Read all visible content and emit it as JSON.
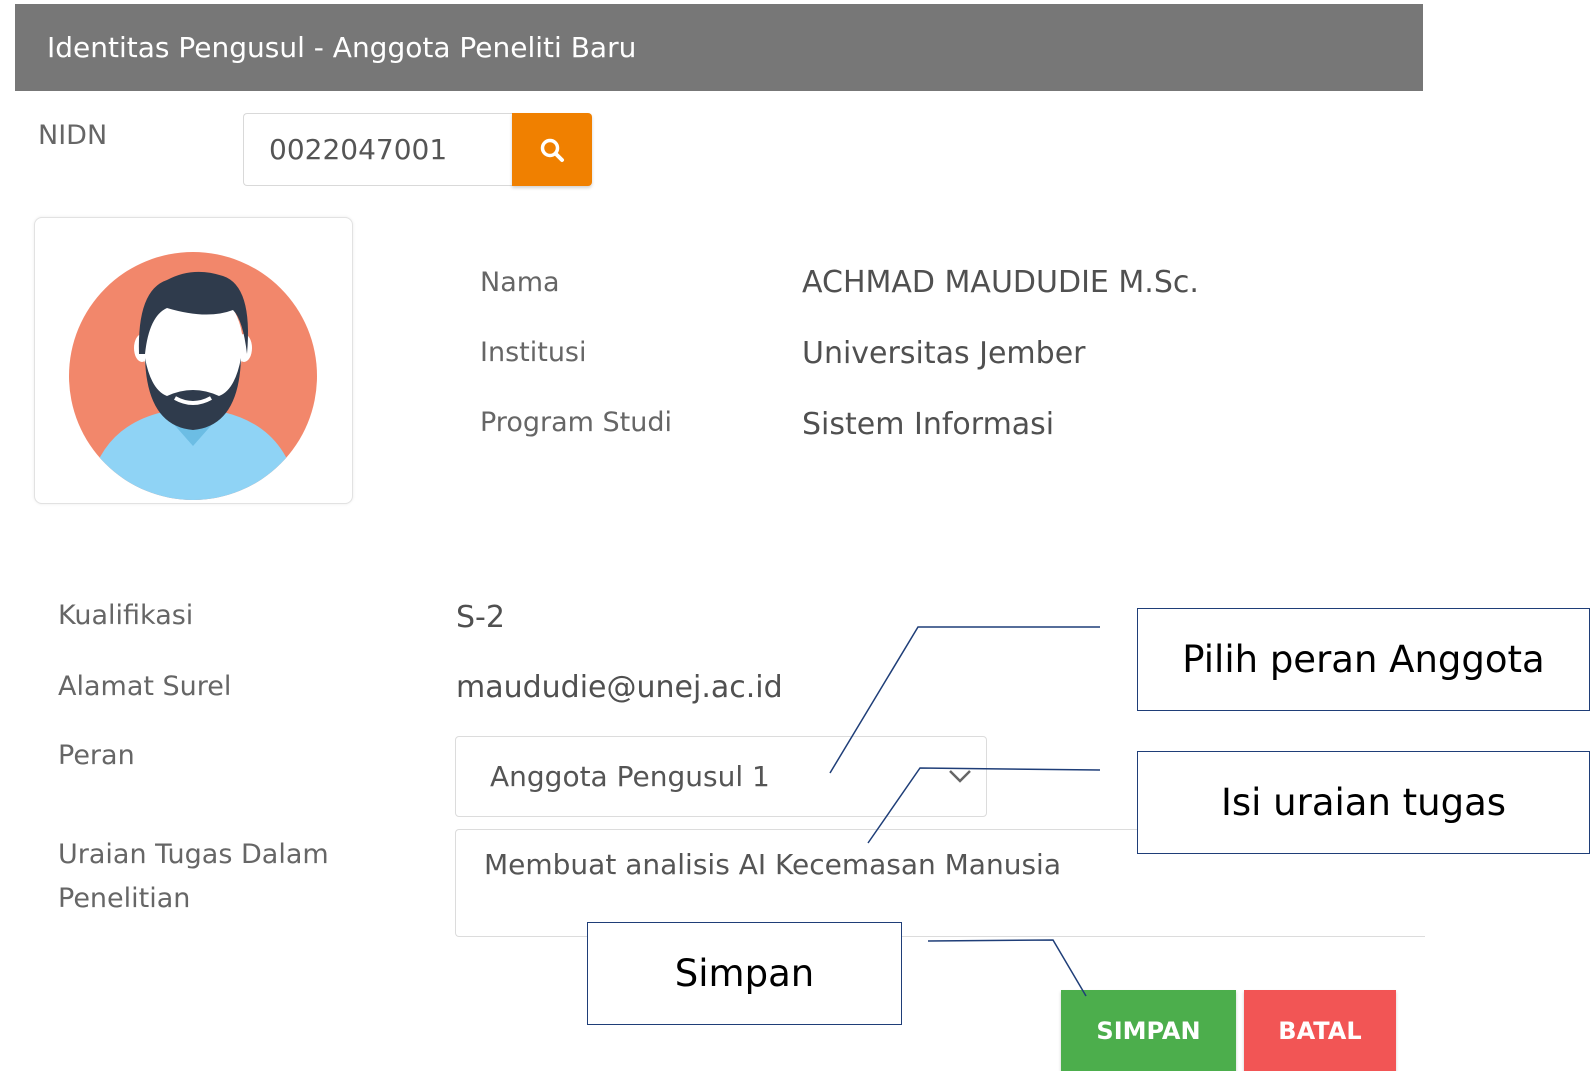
{
  "header": {
    "title": "Identitas Pengusul - Anggota Peneliti Baru"
  },
  "nidn": {
    "label": "NIDN",
    "value": "0022047001",
    "search_icon": "search-icon"
  },
  "profile": {
    "avatar_icon": "user-avatar",
    "fields": [
      {
        "label": "Nama",
        "value": "ACHMAD MAUDUDIE M.Sc."
      },
      {
        "label": "Institusi",
        "value": "Universitas Jember"
      },
      {
        "label": "Program Studi",
        "value": "Sistem Informasi"
      }
    ]
  },
  "details": {
    "kualifikasi_label": "Kualifikasi",
    "kualifikasi_value": "S-2",
    "surel_label": "Alamat Surel",
    "surel_value": "maududie@unej.ac.id",
    "peran_label": "Peran",
    "peran_value": "Anggota Pengusul 1",
    "uraian_label_line1": "Uraian Tugas Dalam",
    "uraian_label_line2": "Penelitian",
    "uraian_value": "Membuat analisis AI Kecemasan Manusia"
  },
  "buttons": {
    "simpan": "SIMPAN",
    "batal": "BATAL"
  },
  "callouts": {
    "peran": "Pilih peran Anggota",
    "uraian": "Isi uraian tugas",
    "simpan": "Simpan"
  },
  "colors": {
    "header_bg": "#777777",
    "search_button": "#f08000",
    "simpan_button": "#4cae4c",
    "batal_button": "#f25555",
    "callout_border": "#1f3e78"
  }
}
